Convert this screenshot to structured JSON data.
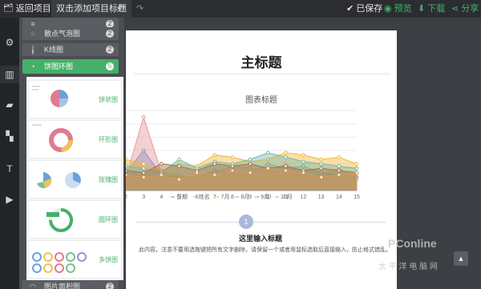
{
  "topbar": {
    "back_label": "返回项目库",
    "project_title": "双击添加项目标题",
    "saved_label": "已保存",
    "preview_label": "预览",
    "download_label": "下载",
    "share_label": "分享"
  },
  "rail": {
    "items": [
      "gear-icon",
      "chart-icon",
      "map-icon",
      "shapes-icon",
      "text-icon",
      "video-icon"
    ]
  },
  "panel": {
    "categories": [
      {
        "label": "",
        "count": "2"
      },
      {
        "label": "散点气泡图",
        "count": "2"
      },
      {
        "label": "K线图",
        "count": "2"
      },
      {
        "label": "饼图环图",
        "count": "5"
      }
    ],
    "thumbnails": [
      {
        "label": "饼状图"
      },
      {
        "label": "环形图"
      },
      {
        "label": "玫瑰图"
      },
      {
        "label": "圆环图"
      },
      {
        "label": "多饼图"
      }
    ],
    "bottom_category": {
      "label": "图片面积图",
      "count": "2"
    }
  },
  "document": {
    "title": "主标题",
    "chart_title": "图表标题",
    "card": {
      "number": "1",
      "title": "这里输入标题",
      "text": "此内容，注意不要用选拖键把所有文字删除，请保留一个或者用鼠标选取后直接输入，防止格式错乱。"
    }
  },
  "chart_data": {
    "type": "area",
    "title": "图表标题",
    "xlabel": "",
    "ylabel": "",
    "x": [
      2,
      3,
      4,
      5,
      6,
      7,
      8,
      9,
      10,
      11,
      12,
      13,
      14,
      15
    ],
    "series": [
      {
        "name": "日期",
        "color": "#4a90d9",
        "values": [
          40,
          90,
          35,
          30,
          30,
          45,
          40,
          38,
          60,
          50,
          55,
          40,
          35,
          30
        ]
      },
      {
        "name": "姓名",
        "color": "#e59a9a",
        "values": [
          30,
          165,
          40,
          35,
          25,
          40,
          55,
          50,
          45,
          60,
          30,
          35,
          50,
          25
        ]
      },
      {
        "name": "7月",
        "color": "#f0b93b",
        "values": [
          70,
          60,
          45,
          60,
          55,
          80,
          75,
          65,
          70,
          85,
          80,
          70,
          75,
          60
        ]
      },
      {
        "name": "8月",
        "color": "#78b7a8",
        "values": [
          55,
          50,
          40,
          70,
          50,
          65,
          60,
          70,
          85,
          75,
          65,
          60,
          55,
          50
        ]
      },
      {
        "name": "9月",
        "color": "#a5734a",
        "values": [
          45,
          40,
          60,
          55,
          45,
          60,
          55,
          60,
          50,
          55,
          45,
          50,
          45,
          40
        ]
      },
      {
        "name": "10月",
        "color": "#d59a5c",
        "values": [
          35,
          30,
          35,
          25,
          40,
          35,
          45,
          40,
          50,
          45,
          40,
          30,
          35,
          40
        ]
      }
    ],
    "ylim": [
      0,
      180
    ],
    "grid": true,
    "legend": "bottom"
  },
  "watermark": {
    "logo_text": "PConline",
    "sub_text": "太 平 洋 电 脑 网"
  }
}
